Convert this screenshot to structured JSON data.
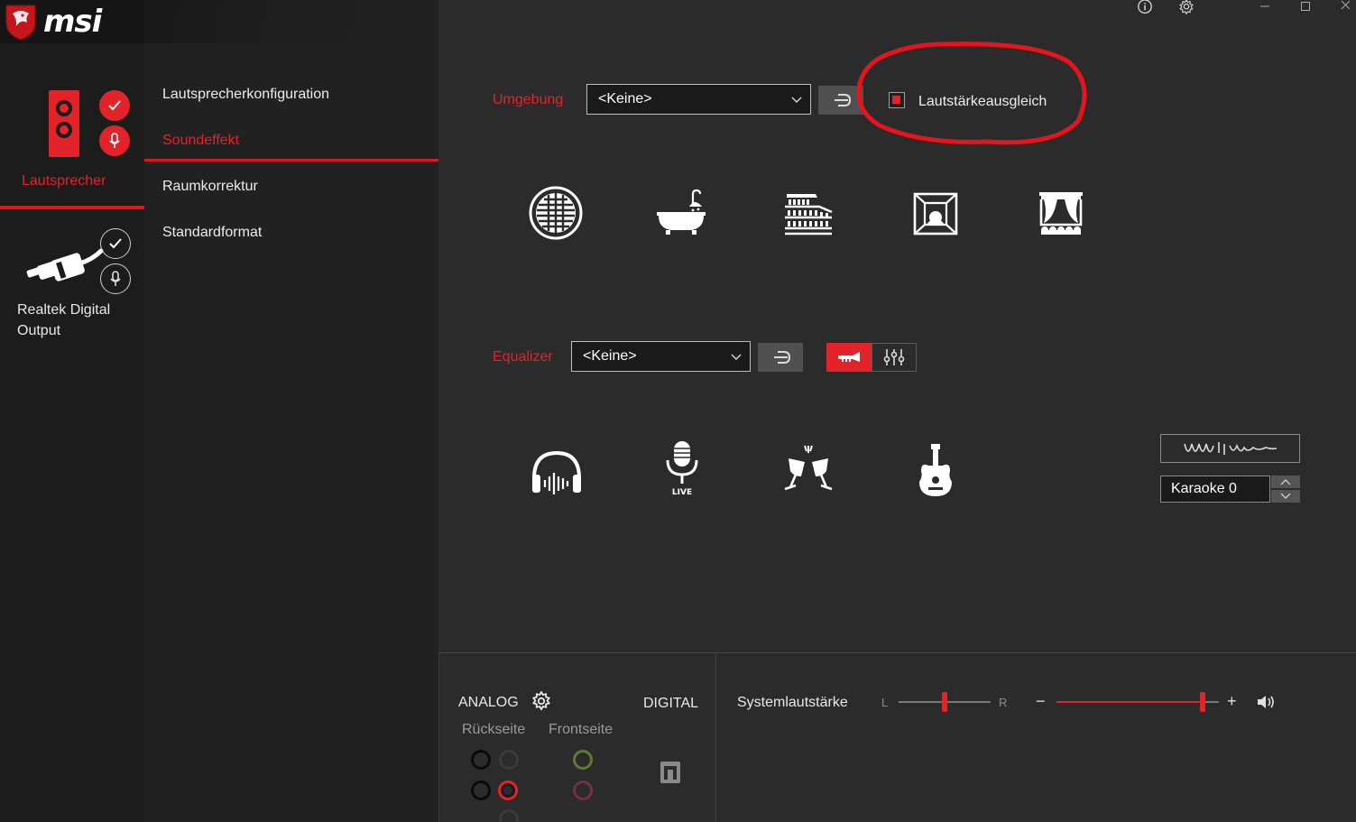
{
  "brand": {
    "name": "msi"
  },
  "devices": [
    {
      "label": "Lautsprecher",
      "active": true
    },
    {
      "label": "Realtek Digital Output",
      "label_line1": "Realtek Digital",
      "label_line2": "Output",
      "active": false
    }
  ],
  "menu": {
    "items": [
      {
        "label": "Lautsprecherkonfiguration",
        "active": false
      },
      {
        "label": "Soundeffekt",
        "active": true
      },
      {
        "label": "Raumkorrektur",
        "active": false
      },
      {
        "label": "Standardformat",
        "active": false
      }
    ]
  },
  "environment": {
    "label": "Umgebung",
    "selected": "<Keine>",
    "loudness_label": "Lautstärkeausgleich",
    "loudness_checked": true,
    "icons": [
      "sewer-pipe-icon",
      "bathroom-icon",
      "arena-icon",
      "stone-room-icon",
      "theater-icon"
    ]
  },
  "equalizer": {
    "label": "Equalizer",
    "selected": "<Keine>",
    "active_mode": "preset",
    "icons": [
      "headphones-icon",
      "live-microphone-icon",
      "party-cheers-icon",
      "guitar-icon"
    ],
    "live_text": "LIVE"
  },
  "karaoke": {
    "label": "Karaoke",
    "value": "0",
    "display": "Karaoke 0"
  },
  "bottom": {
    "analog_label": "ANALOG",
    "digital_label": "DIGITAL",
    "rear_label": "Rückseite",
    "front_label": "Frontseite",
    "system_volume_label": "Systemlautstärke",
    "balance_left": "L",
    "balance_right": "R",
    "minus": "−",
    "plus": "+",
    "balance": 0.5,
    "volume": 0.9
  },
  "colors": {
    "accent": "#e2232a",
    "background": "#2b2b2b",
    "sidebar": "#1c1c1c",
    "submenu": "#212121"
  }
}
